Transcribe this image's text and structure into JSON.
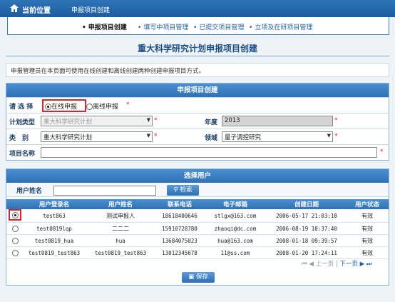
{
  "header": {
    "current_position": "当前位置",
    "breadcrumb": "申报项目创建"
  },
  "steps": [
    {
      "label": "申报项目创建",
      "active": true
    },
    {
      "label": "填写中项目管理",
      "active": false
    },
    {
      "label": "已提交项目管理",
      "active": false
    },
    {
      "label": "立项及在研项目管理",
      "active": false
    }
  ],
  "page_title": "重大科学研究计划申报项目创建",
  "description": "申报管理员在本页面可使用在线创建和离线创建两种创建申报项目方式。",
  "form": {
    "title": "申报项目创建",
    "method_label": "请 选 择",
    "method_online": "在线申报",
    "method_offline": "离线申报",
    "required_mark": "*",
    "plan_type_label": "计划类型",
    "plan_type_value": "重大科学研究计划",
    "year_label": "年度",
    "year_value": "2013",
    "category_label": "类　别",
    "category_value": "重大科学研究计划",
    "field_label": "领域",
    "field_value": "量子调控研究",
    "project_name_label": "项目名称",
    "project_name_value": ""
  },
  "users": {
    "title": "选择用户",
    "search_label": "用户姓名",
    "search_button": "检索",
    "columns": [
      "用户登录名",
      "用户姓名",
      "联系电话",
      "电子邮箱",
      "创建日期",
      "用户状态"
    ],
    "rows": [
      {
        "login": "test863",
        "name": "测试申报人",
        "phone": "18618400646",
        "email": "stlgx@163.com",
        "created": "2006-05-17 21:03:18",
        "status": "有效",
        "selected": true
      },
      {
        "login": "test0819lqp",
        "name": "二二二",
        "phone": "15910728780",
        "email": "zhaoqi@dc.com",
        "created": "2006-08-19 10:37:40",
        "status": "有效",
        "selected": false
      },
      {
        "login": "test0819_hua",
        "name": "hua",
        "phone": "13684075023",
        "email": "hua@163.com",
        "created": "2008-01-18 09:39:57",
        "status": "有效",
        "selected": false
      },
      {
        "login": "test0819_test863",
        "name": "test0819_test863",
        "phone": "13012345678",
        "email": "11@ss.com",
        "created": "2008-01-20 17:24:11",
        "status": "有效",
        "selected": false
      }
    ],
    "pager": {
      "prev": "上一页",
      "next": "下一页"
    },
    "save_button": "保存"
  }
}
